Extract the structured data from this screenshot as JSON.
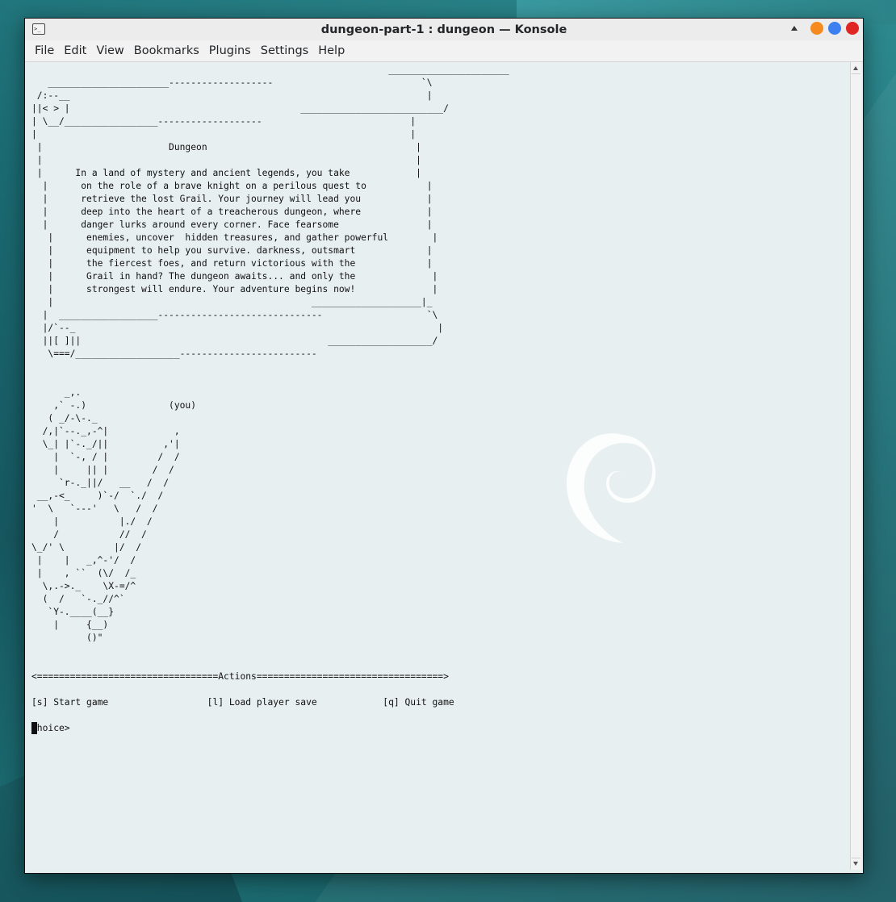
{
  "window": {
    "title": "dungeon-part-1 : dungeon — Konsole",
    "app_icon": "terminal-icon"
  },
  "menubar": {
    "items": [
      "File",
      "Edit",
      "View",
      "Bookmarks",
      "Plugins",
      "Settings",
      "Help"
    ]
  },
  "colors": {
    "minimize": "#f68a1e",
    "maximize": "#3b7ff0",
    "close": "#e02525",
    "terminal_bg": "#e8eff0",
    "desktop": "#1f6f78"
  },
  "terminal": {
    "output": "                                                                 ______________________\n   ______________________-------------------                           `\\\n /:--__                                                                 |\n||< > |                                          __________________________/\n| \\__/_________________-------------------                           |\n|                                                                    |\n |                       Dungeon                                      |\n |                                                                    |\n |      In a land of mystery and ancient legends, you take            |\n  |      on the role of a brave knight on a perilous quest to           |\n  |      retrieve the lost Grail. Your journey will lead you            |\n  |      deep into the heart of a treacherous dungeon, where            |\n  |      danger lurks around every corner. Face fearsome                |\n   |      enemies, uncover  hidden treasures, and gather powerful        |\n   |      equipment to help you survive. darkness, outsmart             |\n   |      the fiercest foes, and return victorious with the             |\n   |      Grail in hand? The dungeon awaits... and only the              |\n   |      strongest will endure. Your adventure begins now!              |\n   |                                               ____________________|_\n  |  __________________------------------------------                   `\\\n  |/`--_                                                                  |\n  ||[ ]||                                             ___________________/\n   \\===/___________________-------------------------\n\n\n      _,.\n    ,` -.)               (you)\n   ( _/-\\-._\n  /,|`--._,-^|            ,\n  \\_| |`-._/||          ,'|\n    |  `-, / |         /  /\n    |     || |        /  /\n     `r-._||/   __   /  /\n __,-<_     )`-/  `./  /\n'  \\   `---'   \\   /  /\n    |           |./  /\n    /           //  /\n\\_/' \\         |/  /\n |    |   _,^-'/  /\n |    , ``  (\\/  /_\n  \\,.->._    \\X-=/^\n  (  /   `-._//^`\n   `Y-.____(__}\n    |     {__)\n          ()\"\n\n\n<=================================Actions==================================>\n\n[s] Start game                  [l] Load player save            [q] Quit game\n\nchoice>"
  }
}
